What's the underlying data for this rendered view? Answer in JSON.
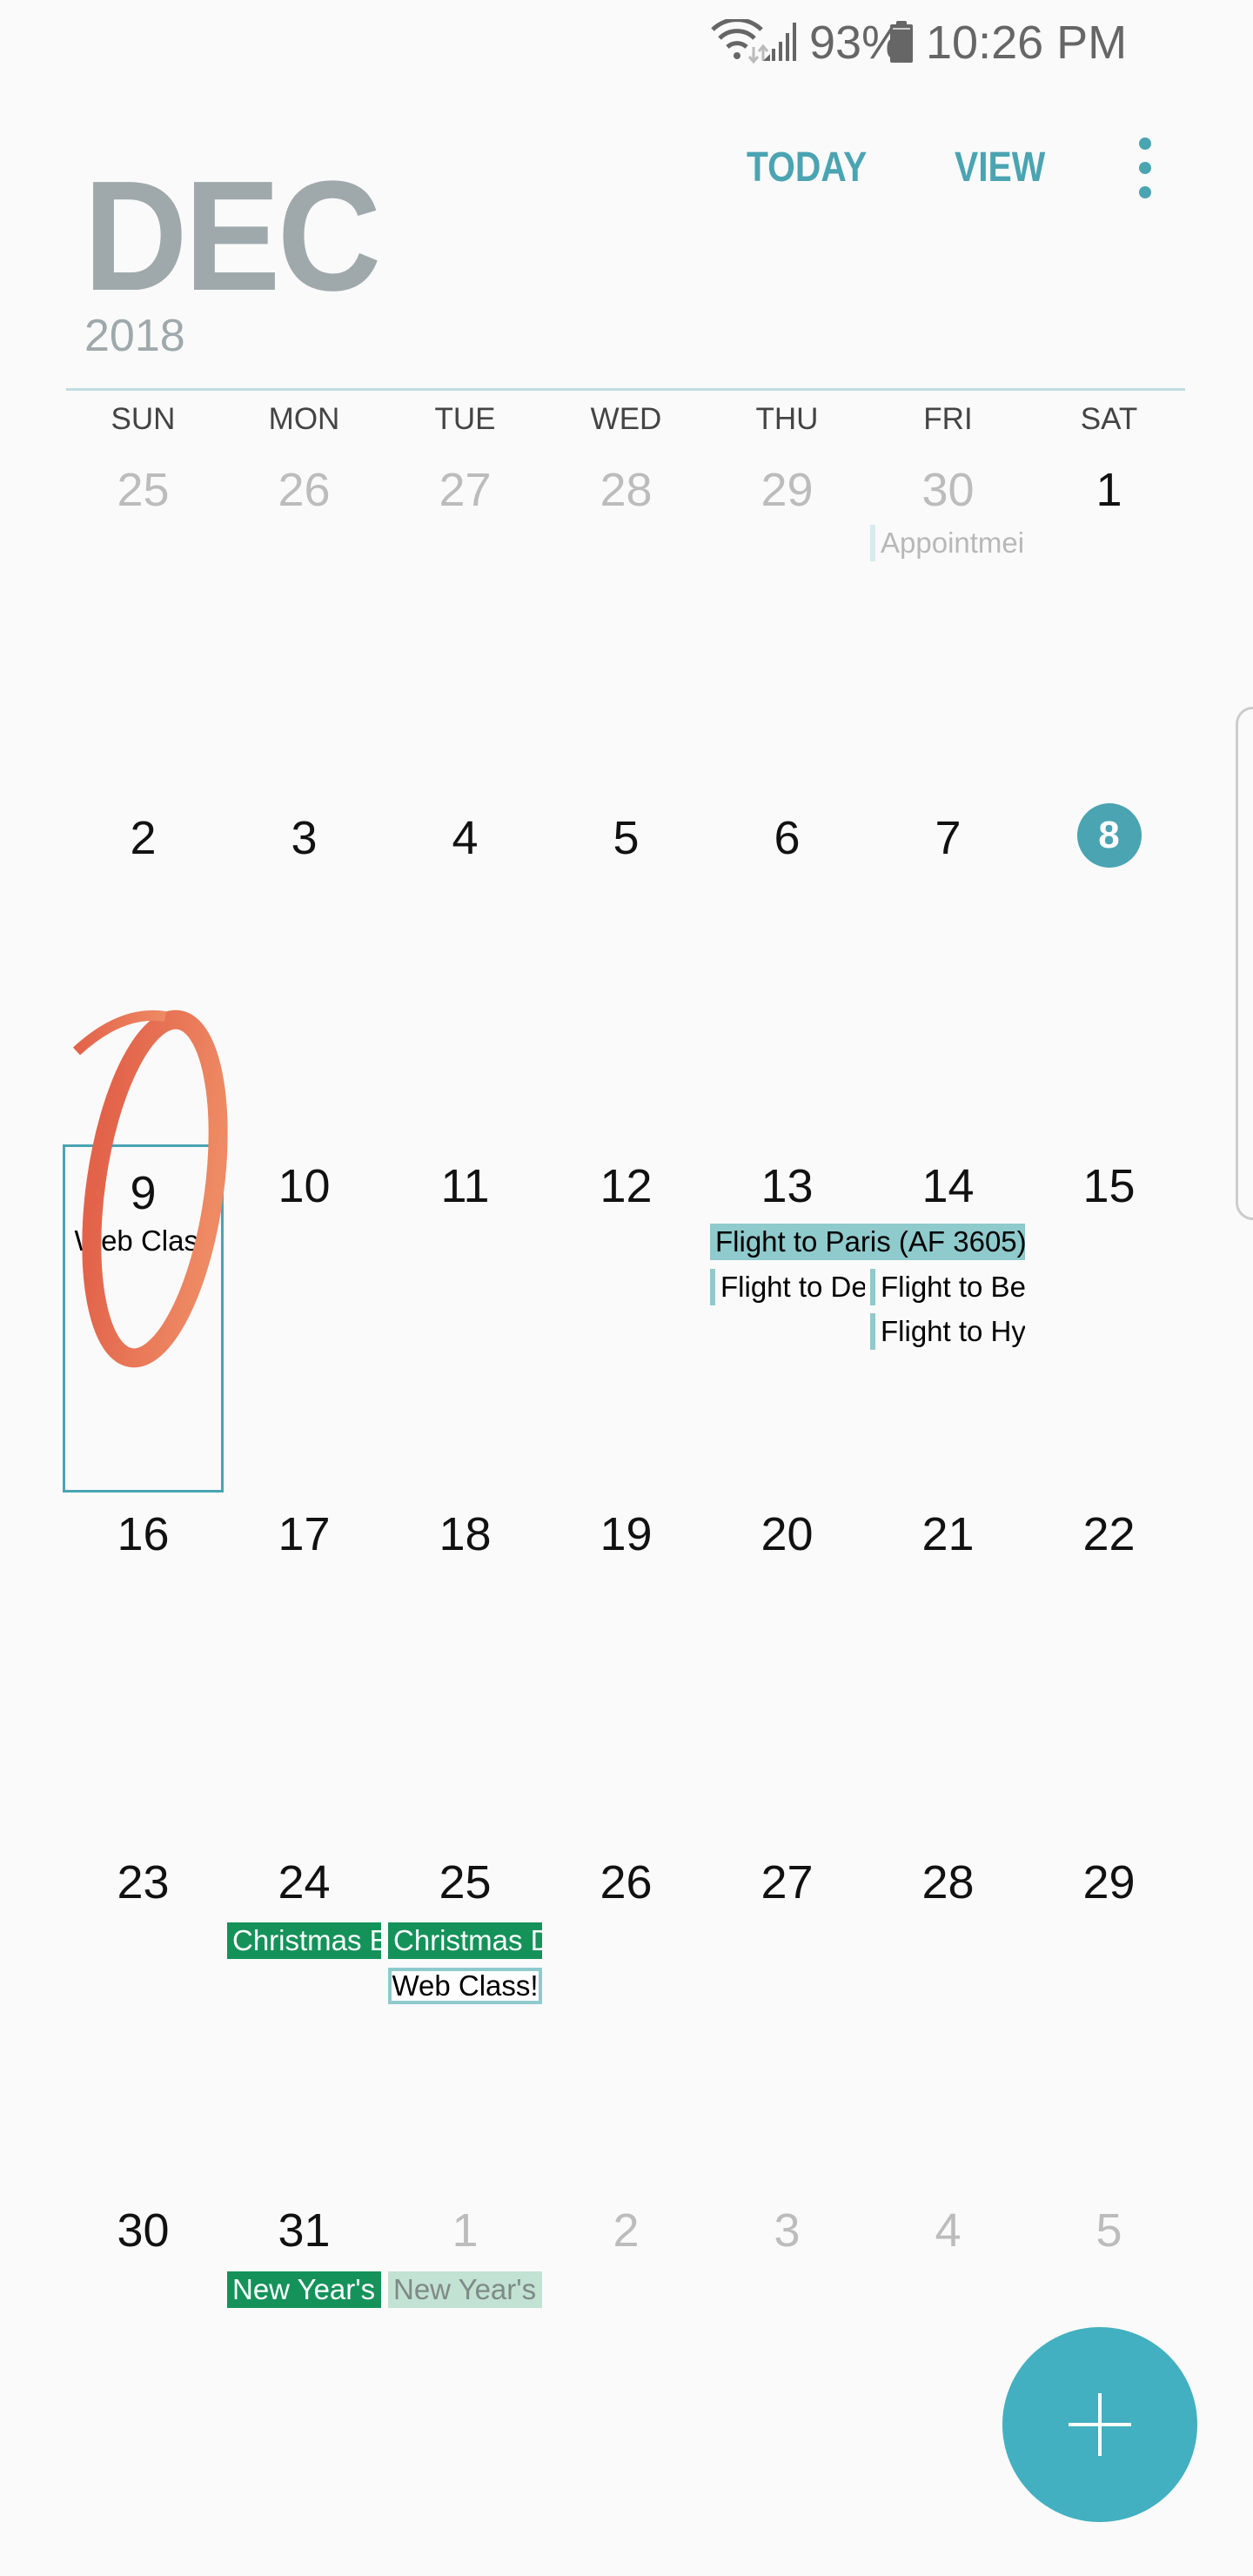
{
  "status_bar": {
    "battery": "93%",
    "time": "10:26 PM",
    "icons": [
      "wifi-icon",
      "signal-icon",
      "battery-icon"
    ]
  },
  "header": {
    "month": "DEC",
    "year": "2018",
    "today_label": "TODAY",
    "view_label": "VIEW",
    "more_icon": "more-vertical-icon"
  },
  "colors": {
    "accent": "#4aa4b2",
    "holiday": "#14925a",
    "event": "#8fcacc",
    "fab": "#42b0c0"
  },
  "weekdays": [
    "SUN",
    "MON",
    "TUE",
    "WED",
    "THU",
    "FRI",
    "SAT"
  ],
  "weeks": [
    [
      "25",
      "26",
      "27",
      "28",
      "29",
      "30",
      "1"
    ],
    [
      "2",
      "3",
      "4",
      "5",
      "6",
      "7",
      "8"
    ],
    [
      "9",
      "10",
      "11",
      "12",
      "13",
      "14",
      "15"
    ],
    [
      "16",
      "17",
      "18",
      "19",
      "20",
      "21",
      "22"
    ],
    [
      "23",
      "24",
      "25",
      "26",
      "27",
      "28",
      "29"
    ],
    [
      "30",
      "31",
      "1",
      "2",
      "3",
      "4",
      "5"
    ]
  ],
  "today": "8",
  "selected": "9",
  "events": {
    "appointment": "Appointmei",
    "web_class_9": "Web Class",
    "flight_paris": "Flight to Paris (AF 3605)",
    "flight_de": "Flight to De",
    "flight_be": "Flight to Be",
    "flight_hy": "Flight to Hy",
    "christmas_eve": "Christmas E",
    "christmas_day": "Christmas D",
    "web_class_25": "Web Class!",
    "new_years_eve": "New Year's E",
    "new_years_day": "New Year's D"
  },
  "fab": {
    "icon": "plus-icon"
  }
}
